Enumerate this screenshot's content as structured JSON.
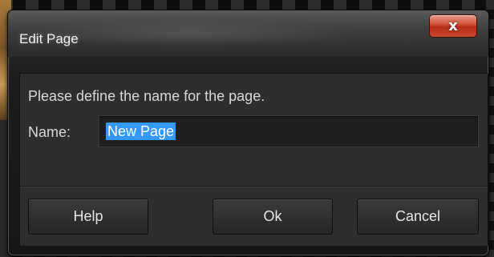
{
  "dialog": {
    "title": "Edit Page",
    "close_icon": "close-icon",
    "close_glyph": "x",
    "prompt": "Please define the name for the page.",
    "name_label": "Name:",
    "name_value": "New Page",
    "buttons": {
      "help": "Help",
      "ok": "Ok",
      "cancel": "Cancel"
    }
  },
  "colors": {
    "selection": "#3399ff",
    "close_button": "#c8472d",
    "panel_bg": "#2e2e2e"
  }
}
